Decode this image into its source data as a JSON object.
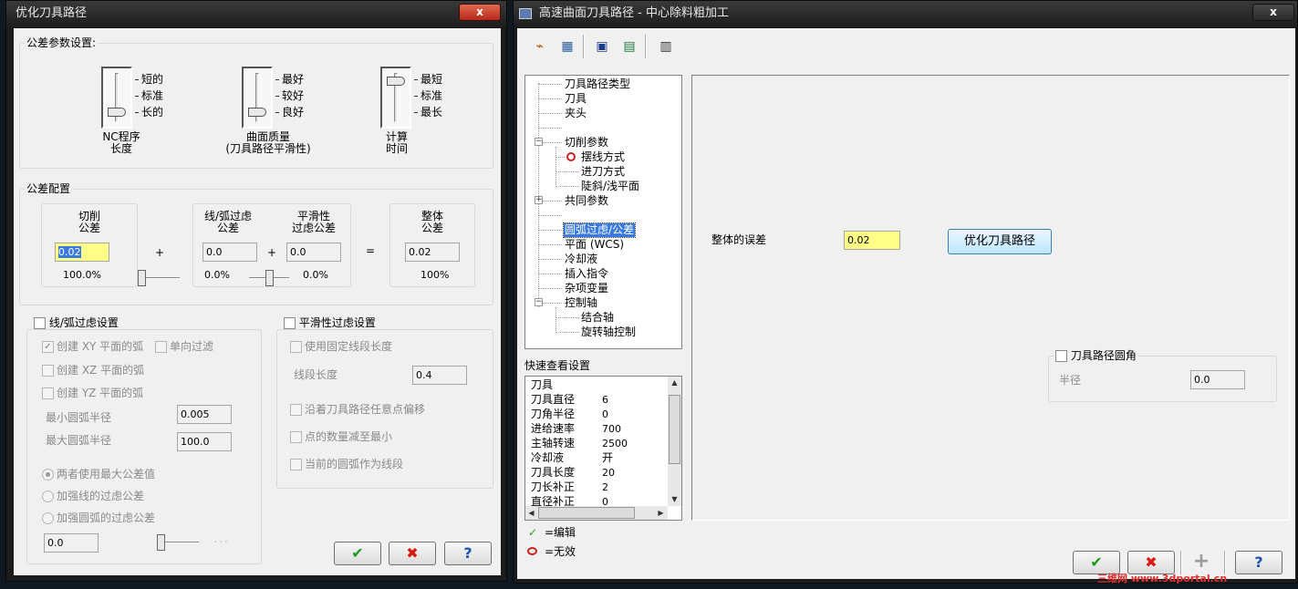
{
  "left_dialog": {
    "title": "优化刀具路径",
    "close": "x",
    "tolerance_settings": {
      "title": "公差参数设置:",
      "nc_length": {
        "ticks": [
          "短的",
          "标准",
          "长的"
        ],
        "caption1": "NC程序",
        "caption2": "长度",
        "level": "长的"
      },
      "surface_quality": {
        "ticks": [
          "最好",
          "较好",
          "良好"
        ],
        "caption1": "曲面质量",
        "caption2": "(刀具路径平滑性)",
        "level": "良好"
      },
      "compute_time": {
        "ticks": [
          "最短",
          "标准",
          "最长"
        ],
        "caption1": "计算",
        "caption2": "时间",
        "level": "最短"
      }
    },
    "tolerance_config": {
      "title": "公差配置",
      "cut": {
        "label1": "切削",
        "label2": "公差",
        "value": "0.02",
        "percent": "100.0%"
      },
      "plus1": "+",
      "arc_filter": {
        "label1": "线/弧过虑",
        "label2": "公差",
        "value": "0.0",
        "percent": "0.0%"
      },
      "plus2": "+",
      "smooth": {
        "label1": "平滑性",
        "label2": "过虑公差",
        "value": "0.0",
        "percent": "0.0%"
      },
      "equals": "=",
      "total": {
        "label1": "整体",
        "label2": "公差",
        "value": "0.02",
        "percent": "100%"
      }
    },
    "arc_group": {
      "title": "线/弧过虑设置",
      "create_xy": "创建 XY 平面的弧",
      "one_way": "单向过滤",
      "create_xz": "创建 XZ 平面的弧",
      "create_yz": "创建 YZ 平面的弧",
      "min_radius_label": "最小圆弧半径",
      "min_radius": "0.005",
      "max_radius_label": "最大圆弧半径",
      "max_radius": "100.0",
      "opt_both": "两者使用最大公差值",
      "opt_line": "加强线的过虑公差",
      "opt_arc": "加强圆弧的过虑公差",
      "value": "0.0",
      "dots": "· · ·"
    },
    "smooth_group": {
      "title": "平滑性过虑设置",
      "fixed_len": "使用固定线段长度",
      "seg_len_label": "线段长度",
      "seg_len": "0.4",
      "offset_any": "沿着刀具路径任意点偏移",
      "reduce_points": "点的数量减至最小",
      "arc_as_line": "当前的圆弧作为线段"
    },
    "buttons": {
      "ok": "✔",
      "cancel": "✖",
      "help": "?"
    }
  },
  "right_dialog": {
    "title": "高速曲面刀具路径 - 中心除料粗加工",
    "close": "x",
    "toolbar": {
      "icon1": "⌁",
      "icon2": "▦",
      "icon3": "▣",
      "icon4": "▤",
      "icon5": "▥"
    },
    "tree": [
      {
        "label": "刀具路径类型"
      },
      {
        "label": "刀具"
      },
      {
        "label": "夹头"
      },
      {
        "label": ""
      },
      {
        "label": "切削参数"
      },
      {
        "label": "摆线方式"
      },
      {
        "label": "进刀方式"
      },
      {
        "label": "陡斜/浅平面"
      },
      {
        "label": "共同参数"
      },
      {
        "label": ""
      },
      {
        "label": "圆弧过虑/公差"
      },
      {
        "label": "平面 (WCS)"
      },
      {
        "label": "冷却液"
      },
      {
        "label": "插入指令"
      },
      {
        "label": "杂项变量"
      },
      {
        "label": "控制轴"
      },
      {
        "label": "结合轴"
      },
      {
        "label": "旋转轴控制"
      }
    ],
    "quick_view": {
      "title": "快速查看设置",
      "rows": [
        {
          "k": "刀具",
          "v": ""
        },
        {
          "k": "刀具直径",
          "v": "6"
        },
        {
          "k": "刀角半径",
          "v": "0"
        },
        {
          "k": "进给速率",
          "v": "700"
        },
        {
          "k": "主轴转速",
          "v": "2500"
        },
        {
          "k": "冷却液",
          "v": "开"
        },
        {
          "k": "刀具长度",
          "v": "20"
        },
        {
          "k": "刀长补正",
          "v": "2"
        },
        {
          "k": "直径补正",
          "v": "0"
        }
      ]
    },
    "legend_edit": "=编辑",
    "legend_invalid": "=无效",
    "overall_label": "整体的误差",
    "overall_value": "0.02",
    "optimize_button": "优化刀具路径",
    "fillet": {
      "title": "刀具路径圆角",
      "radius_label": "半径",
      "radius": "0.0"
    },
    "buttons": {
      "ok": "✔",
      "cancel": "✖",
      "add": "+",
      "help": "?"
    }
  },
  "watermark": "三维网 www.3dportal.cn"
}
